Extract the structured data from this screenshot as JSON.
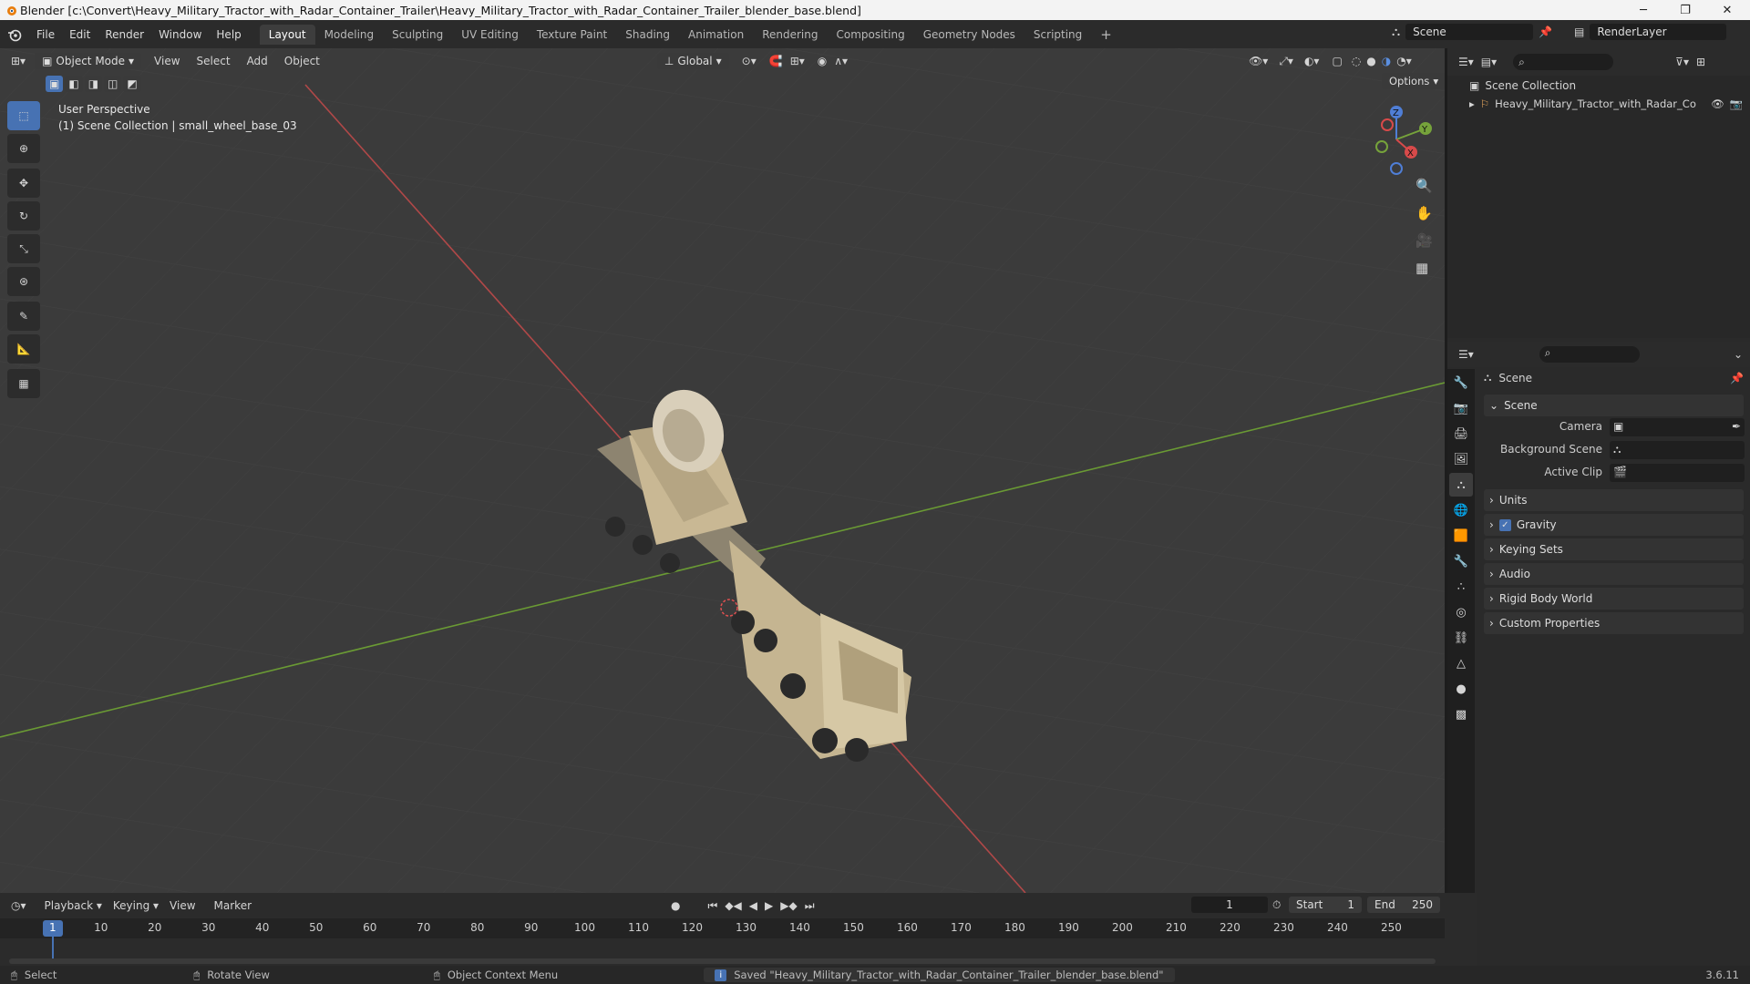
{
  "window": {
    "title": "Blender [c:\\Convert\\Heavy_Military_Tractor_with_Radar_Container_Trailer\\Heavy_Military_Tractor_with_Radar_Container_Trailer_blender_base.blend]",
    "minimize_icon": "minimize-icon",
    "maximize_icon": "maximize-icon",
    "close_icon": "close-icon"
  },
  "menu": [
    "File",
    "Edit",
    "Render",
    "Window",
    "Help"
  ],
  "workspaces": [
    {
      "label": "Layout",
      "active": true
    },
    {
      "label": "Modeling"
    },
    {
      "label": "Sculpting"
    },
    {
      "label": "UV Editing"
    },
    {
      "label": "Texture Paint"
    },
    {
      "label": "Shading"
    },
    {
      "label": "Animation"
    },
    {
      "label": "Rendering"
    },
    {
      "label": "Compositing"
    },
    {
      "label": "Geometry Nodes"
    },
    {
      "label": "Scripting"
    }
  ],
  "top_right": {
    "scene": "Scene",
    "render_layer": "RenderLayer"
  },
  "viewport": {
    "mode": "Object Mode",
    "menus": [
      "View",
      "Select",
      "Add",
      "Object"
    ],
    "transform_orientation": "Global",
    "options_label": "Options",
    "overlay_line1": "User Perspective",
    "overlay_line2": "(1) Scene Collection | small_wheel_base_03",
    "gizmo_axes": {
      "x": "X",
      "y": "Y",
      "z": "Z"
    }
  },
  "outliner": {
    "root": "Scene Collection",
    "item": "Heavy_Military_Tractor_with_Radar_Co"
  },
  "properties": {
    "context": "Scene",
    "section": "Scene",
    "fields": [
      {
        "label": "Camera"
      },
      {
        "label": "Background Scene"
      },
      {
        "label": "Active Clip"
      }
    ],
    "panels": [
      "Units",
      "Gravity",
      "Keying Sets",
      "Audio",
      "Rigid Body World",
      "Custom Properties"
    ],
    "gravity_checked": true
  },
  "timeline": {
    "menus": [
      "Playback",
      "Keying",
      "View",
      "Marker"
    ],
    "current_frame": "1",
    "start_label": "Start",
    "start": "1",
    "end_label": "End",
    "end": "250",
    "ticks": [
      "1",
      "10",
      "20",
      "30",
      "40",
      "50",
      "60",
      "70",
      "80",
      "90",
      "100",
      "110",
      "120",
      "130",
      "140",
      "150",
      "160",
      "170",
      "180",
      "190",
      "200",
      "210",
      "220",
      "230",
      "240",
      "250"
    ]
  },
  "statusbar": {
    "select": "Select",
    "rotate": "Rotate View",
    "context_menu": "Object Context Menu",
    "message": "Saved \"Heavy_Military_Tractor_with_Radar_Container_Trailer_blender_base.blend\"",
    "version": "3.6.11"
  }
}
